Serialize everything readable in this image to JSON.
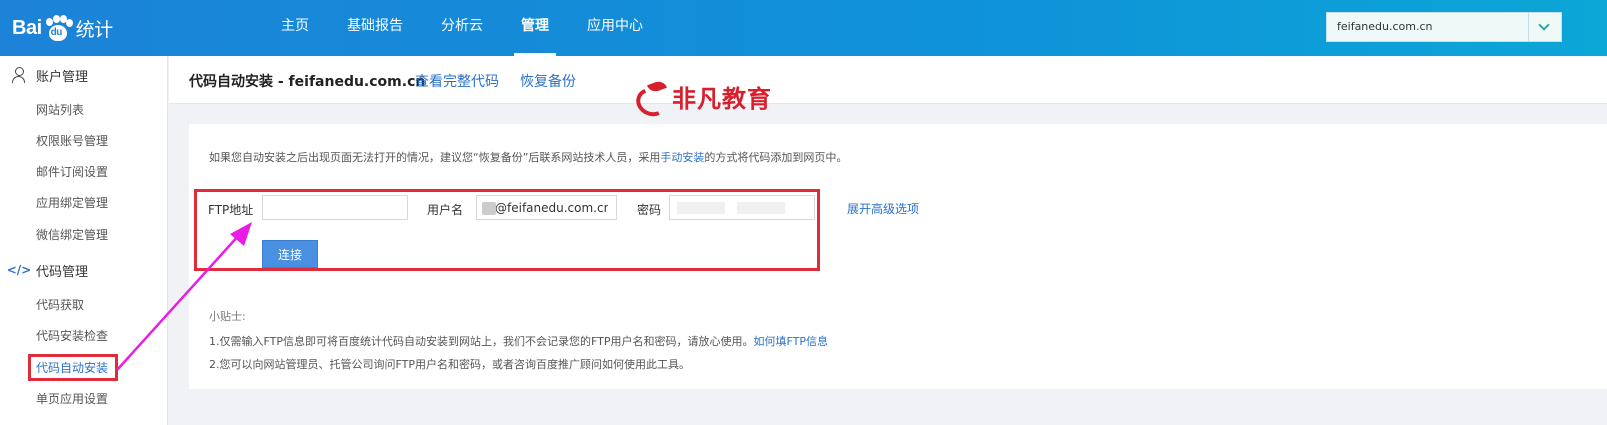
{
  "header": {
    "logo_text_left": "Bai",
    "logo_paw_text": "du",
    "logo_text_cn": "统计",
    "nav": [
      {
        "label": "主页",
        "active": false
      },
      {
        "label": "基础报告",
        "active": false
      },
      {
        "label": "分析云",
        "active": false
      },
      {
        "label": "管理",
        "active": true
      },
      {
        "label": "应用中心",
        "active": false
      }
    ],
    "site_select_value": "feifanedu.com.cn"
  },
  "sidebar": {
    "account_group": "账户管理",
    "account_items": [
      "网站列表",
      "权限账号管理",
      "邮件订阅设置",
      "应用绑定管理",
      "微信绑定管理"
    ],
    "code_group": "代码管理",
    "code_group_icon_text": "</>",
    "code_items": [
      "代码获取",
      "代码安装检查",
      "代码自动安装",
      "单页应用设置"
    ],
    "active_item": "代码自动安装"
  },
  "topbar": {
    "title": "代码自动安装 - feifanedu.com.cn",
    "link_view_code": "查看完整代码",
    "link_restore": "恢复备份",
    "brand_text": "非凡教育"
  },
  "panel": {
    "notice_before": "如果您自动安装之后出现页面无法打开的情况，建议您“恢复备份”后联系网站技术人员，采用",
    "notice_link": "手动安装",
    "notice_after": "的方式将代码添加到网页中。",
    "ftp_label": "FTP地址",
    "ftp_value": "",
    "ftp_placeholder": "",
    "user_label": "用户名",
    "user_value": "@feifanedu.com.cn",
    "pw_label": "密码",
    "pw_value": "",
    "advanced_link": "展开高级选项",
    "connect_label": "连接",
    "tips_title": "小贴士:",
    "tip1_text": "1.仅需输入FTP信息即可将百度统计代码自动安装到网站上，我们不会记录您的FTP用户名和密码，请放心使用。",
    "tip1_link": "如何填FTP信息",
    "tip2_text": "2.您可以向网站管理员、托管公司询问FTP用户名和密码，或者咨询百度推广顾问如何使用此工具。"
  },
  "colors": {
    "header_start": "#1c83d8",
    "header_end": "#0ca6d7",
    "link": "#2a72c9",
    "button": "#4a90e2",
    "highlight_red": "#e02b3a",
    "arrow_magenta": "#e81ce6",
    "brand_red": "#d8202c"
  },
  "icons": {
    "account": "person-icon",
    "code": "code-brackets-icon",
    "select": "chevron-down-icon"
  }
}
